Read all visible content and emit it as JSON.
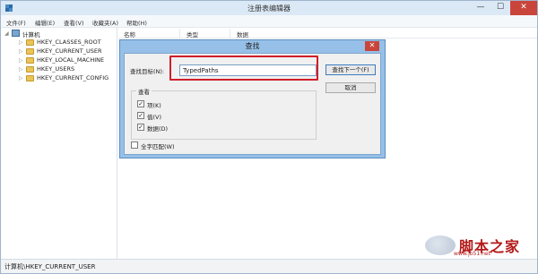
{
  "window": {
    "title": "注册表编辑器",
    "controls": {
      "minimize": "—",
      "maximize": "☐",
      "close": "✕"
    }
  },
  "menu": [
    "文件(F)",
    "编辑(E)",
    "查看(V)",
    "收藏夹(A)",
    "帮助(H)"
  ],
  "tree": {
    "root": "计算机",
    "items": [
      "HKEY_CLASSES_ROOT",
      "HKEY_CURRENT_USER",
      "HKEY_LOCAL_MACHINE",
      "HKEY_USERS",
      "HKEY_CURRENT_CONFIG"
    ]
  },
  "list": {
    "columns": [
      "名称",
      "类型",
      "数据"
    ]
  },
  "status": {
    "path": "计算机\\HKEY_CURRENT_USER"
  },
  "find_dialog": {
    "title": "查找",
    "close": "✕",
    "find_what_label": "查找目标(N):",
    "find_what_value": "TypedPaths",
    "find_next_button": "查找下一个(F)",
    "cancel_button": "取消",
    "look_at_label": "查看",
    "options": [
      {
        "label": "项(K)",
        "checked": true
      },
      {
        "label": "值(V)",
        "checked": true
      },
      {
        "label": "数据(D)",
        "checked": true
      }
    ],
    "match_whole": {
      "label": "全字匹配(W)",
      "checked": false
    }
  },
  "watermark": {
    "text": "脚本之家",
    "url": "www.jb51.net"
  },
  "colors": {
    "dialog_frame": "#96c0e8",
    "highlight": "#d01e2a",
    "close_red": "#c9453b"
  }
}
